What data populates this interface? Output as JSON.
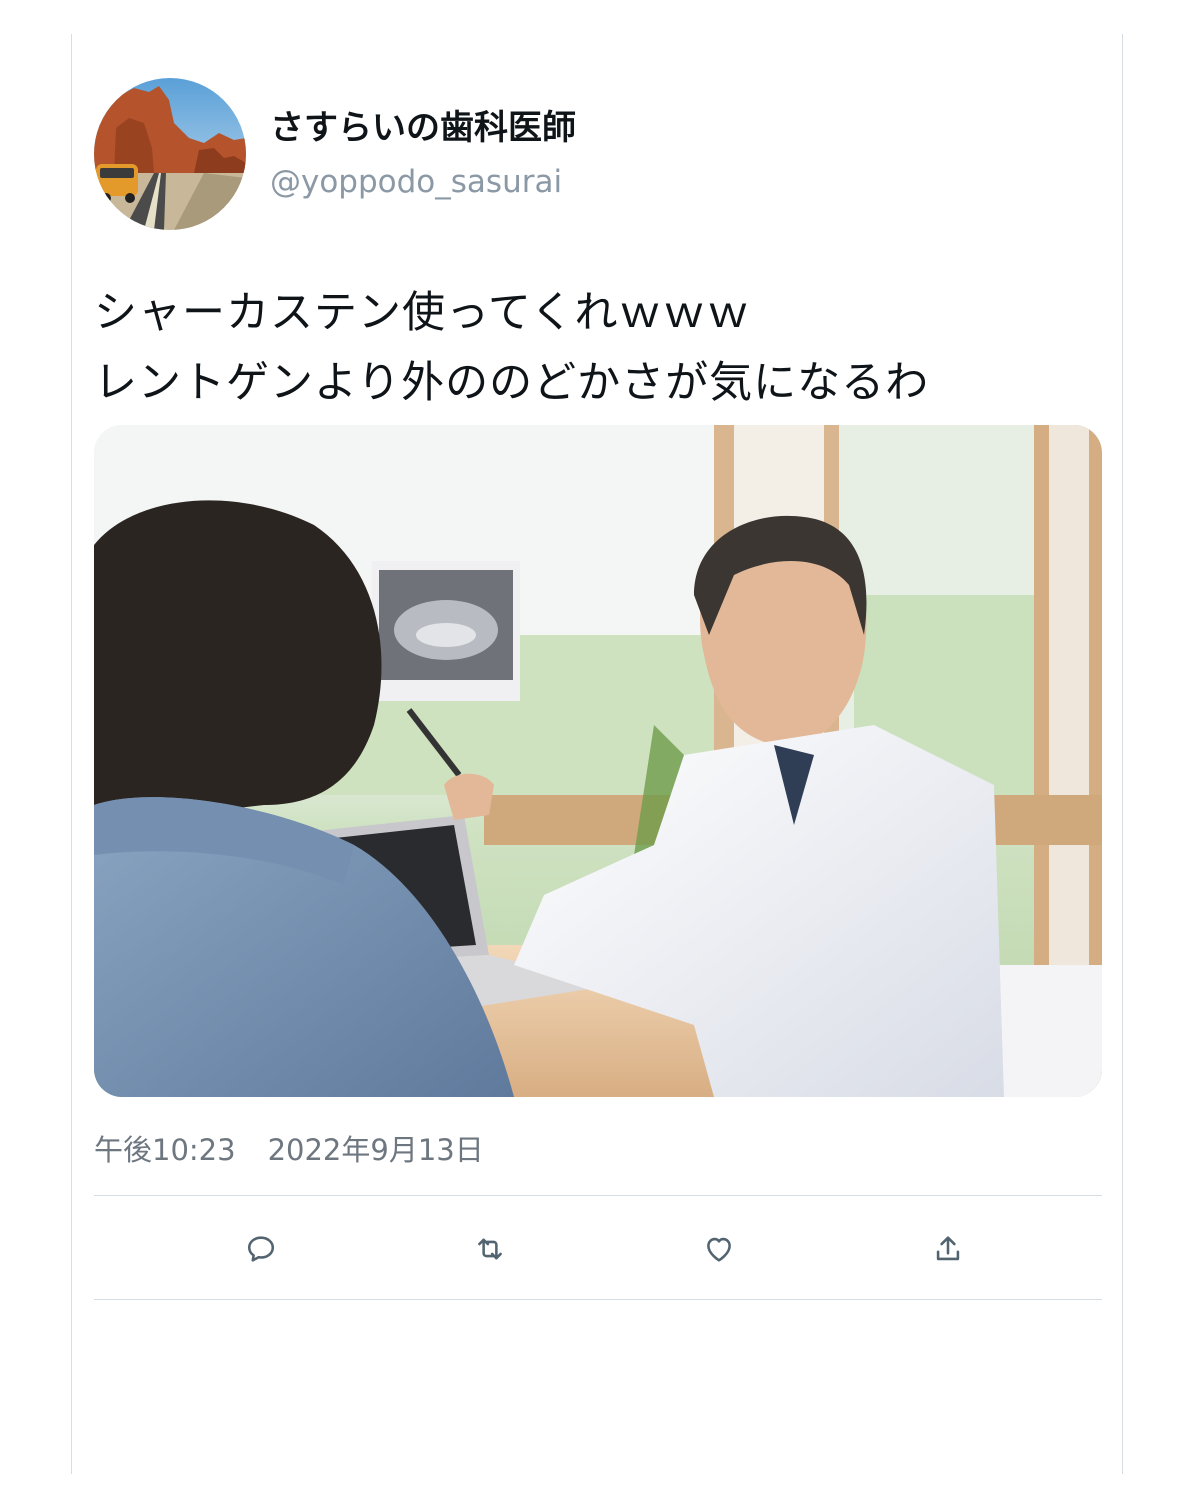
{
  "user": {
    "display_name": "さすらいの歯科医師",
    "handle": "@yoppodo_sasurai",
    "avatar_icon": "avatar-desert-road-van"
  },
  "tweet": {
    "lines": [
      "シャーカステン使ってくれｗｗｗ",
      "レントゲンより外ののどかさが気になるわ"
    ],
    "media_description_icon": "photo-dentist-showing-xray"
  },
  "meta": {
    "time": "午後10:23",
    "date": "2022年9月13日"
  },
  "actions": [
    {
      "name": "reply",
      "icon": "reply-icon"
    },
    {
      "name": "retweet",
      "icon": "retweet-icon"
    },
    {
      "name": "like",
      "icon": "heart-icon"
    },
    {
      "name": "share",
      "icon": "share-icon"
    }
  ],
  "colors": {
    "text_primary": "#0f1419",
    "text_secondary": "#8b98a5",
    "divider": "#d8dde2",
    "icon": "#536471"
  }
}
